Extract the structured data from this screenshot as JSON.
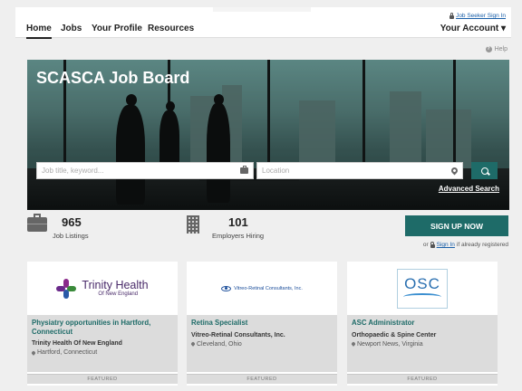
{
  "nav": {
    "items": [
      "Home",
      "Jobs",
      "Your Profile",
      "Resources"
    ],
    "signin_link": "Job Seeker Sign In",
    "account": "Your Account ▾"
  },
  "help": "Help",
  "hero": {
    "title": "SCASCA Job Board",
    "keyword_placeholder": "Job title, keyword...",
    "location_placeholder": "Location",
    "advanced_search": "Advanced Search"
  },
  "stats": {
    "jobs_count": "965",
    "jobs_label": "Job Listings",
    "employers_count": "101",
    "employers_label": "Employers Hiring"
  },
  "signup": {
    "button": "SIGN UP NOW",
    "prefix": "or",
    "link": "Sign In",
    "suffix": "if already registered"
  },
  "jobs": [
    {
      "logo_text": "Trinity Health",
      "logo_subtext": "Of New England",
      "title": "Physiatry opportunities in Hartford, Connecticut",
      "company": "Trinity Health Of New England",
      "location": "Hartford, Connecticut",
      "badge": "FEATURED"
    },
    {
      "logo_text": "Vitreo-Retinal Consultants, Inc.",
      "title": "Retina Specialist",
      "company": "Vitreo-Retinal Consultants, Inc.",
      "location": "Cleveland, Ohio",
      "badge": "FEATURED"
    },
    {
      "logo_text": "OSC",
      "title": "ASC Administrator",
      "company": "Orthopaedic & Spine Center",
      "location": "Newport News, Virginia",
      "badge": "FEATURED"
    }
  ],
  "colors": {
    "accent": "#1e6b68",
    "link": "#1a5fa8",
    "trinity_purple": "#4a2b6a"
  }
}
